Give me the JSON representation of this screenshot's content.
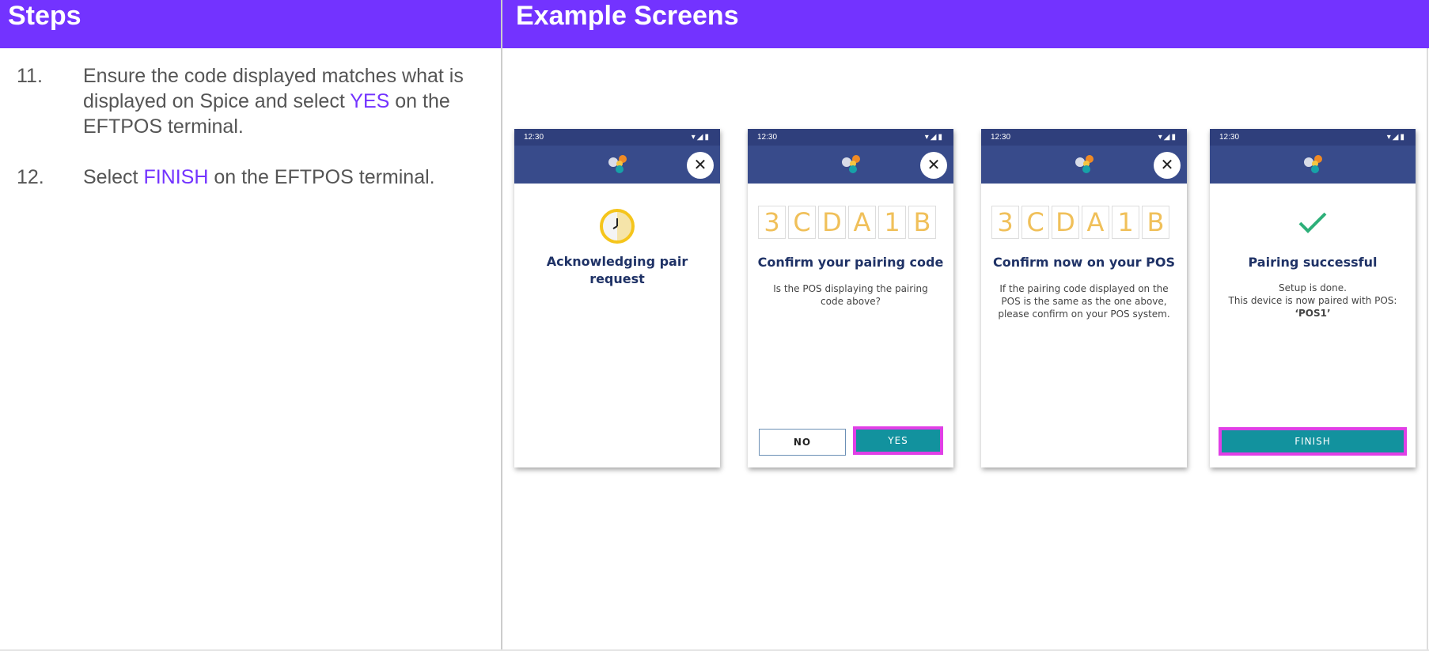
{
  "headers": {
    "left": "Steps",
    "right": "Example Screens"
  },
  "steps": [
    {
      "num": "11.",
      "pre": "Ensure the code displayed matches what is displayed on Spice and select ",
      "highlight": "YES",
      "post": " on the EFTPOS terminal."
    },
    {
      "num": "12.",
      "pre": "Select ",
      "highlight": "FINISH",
      "post": " on the EFTPOS terminal."
    }
  ],
  "colors": {
    "header": "#7333ff",
    "highlight": "#7333ff",
    "appbar": "#384b8b",
    "button": "#12929e",
    "callout": "#e03fe6",
    "code": "#f0c05a"
  },
  "screens": [
    {
      "time": "12:30",
      "title": "Acknowledging pair request",
      "icon": "clock-icon"
    },
    {
      "time": "12:30",
      "title": "Confirm your pairing code",
      "code": [
        "3",
        "C",
        "D",
        "A",
        "1",
        "B"
      ],
      "message": "Is the POS displaying the pairing code above?",
      "no_label": "NO",
      "yes_label": "YES"
    },
    {
      "time": "12:30",
      "title": "Confirm now on your POS",
      "code": [
        "3",
        "C",
        "D",
        "A",
        "1",
        "B"
      ],
      "message": "If the pairing code displayed on the POS is the same as the one above, please confirm on your POS system."
    },
    {
      "time": "12:30",
      "title": "Pairing successful",
      "message_line1": "Setup is done.",
      "message_line2": "This device is now paired with POS:",
      "pos_name": "‘POS1’",
      "finish_label": "FINISH",
      "icon": "checkmark-icon"
    }
  ]
}
